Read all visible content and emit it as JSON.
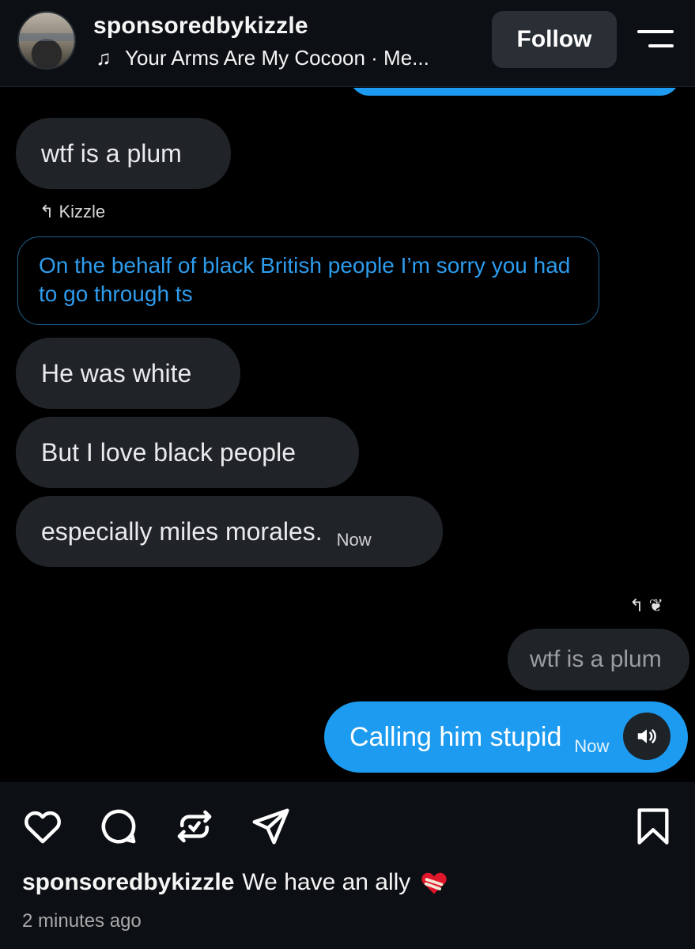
{
  "header": {
    "username": "sponsoredbykizzle",
    "music": "Your Arms Are My Cocoon · Me...",
    "follow_label": "Follow"
  },
  "chat": {
    "msg1": "wtf is a plum",
    "reply_label": "Kizzle",
    "quote": "On the behalf of black British people I’m sorry you had to go through ts",
    "msg2": "He was white",
    "msg3": "But I love black people",
    "msg4": "especially miles morales.",
    "msg4_time": "Now",
    "reply_quote": "wtf is a plum",
    "sent": "Calling him stupid",
    "sent_time": "Now"
  },
  "footer": {
    "caption_user": "sponsoredbykizzle",
    "caption_text": "We have an ally",
    "time_ago": "2 minutes ago"
  },
  "colors": {
    "accent_blue": "#1d9bf0",
    "bubble_gray": "#202327",
    "quote_text": "#2e9cec"
  },
  "icons": [
    "music-note-icon",
    "menu-icon",
    "reply-arrow-icon",
    "speaker-icon",
    "heart-icon",
    "comment-icon",
    "repost-icon",
    "share-icon",
    "bookmark-icon",
    "mending-heart-emoji"
  ]
}
